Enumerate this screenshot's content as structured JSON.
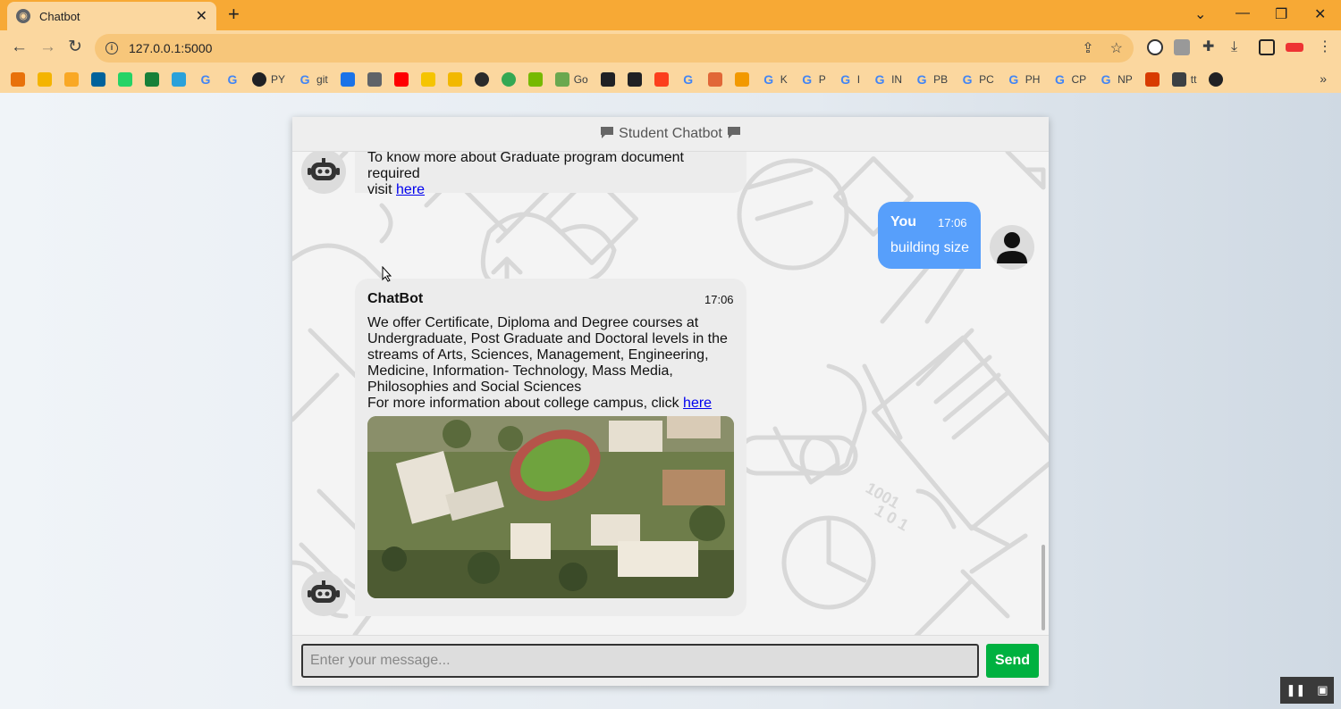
{
  "browser": {
    "tab_title": "Chatbot",
    "url": "127.0.0.1:5000",
    "bookmarks": [
      {
        "label": "",
        "icon": "bm-arrow"
      },
      {
        "label": "",
        "icon": "bm-box"
      },
      {
        "label": "",
        "icon": "bm-chart"
      },
      {
        "label": "",
        "icon": "bm-ieee"
      },
      {
        "label": "",
        "icon": "bm-whatsapp"
      },
      {
        "label": "",
        "icon": "bm-plus"
      },
      {
        "label": "",
        "icon": "bm-telegram"
      },
      {
        "label": "",
        "icon": "google"
      },
      {
        "label": "",
        "icon": "google"
      },
      {
        "label": "PY",
        "icon": "github"
      },
      {
        "label": "git",
        "icon": "google"
      },
      {
        "label": "",
        "icon": "bm-bracket"
      },
      {
        "label": "",
        "icon": "bm-stack"
      },
      {
        "label": "",
        "icon": "bm-youtube"
      },
      {
        "label": "",
        "icon": "bm-p"
      },
      {
        "label": "",
        "icon": "bm-folder"
      },
      {
        "label": "",
        "icon": "bm-dark"
      },
      {
        "label": "",
        "icon": "bm-ring"
      },
      {
        "label": "",
        "icon": "bm-nvidia"
      },
      {
        "label": "Go",
        "icon": "bm-leaf"
      },
      {
        "label": "",
        "icon": "bm-pen"
      },
      {
        "label": "",
        "icon": "bm-cl"
      },
      {
        "label": "",
        "icon": "bm-ya"
      },
      {
        "label": "",
        "icon": "google"
      },
      {
        "label": "",
        "icon": "bm-matlab"
      },
      {
        "label": "",
        "icon": "bm-cloud"
      },
      {
        "label": "K",
        "icon": "google"
      },
      {
        "label": "P",
        "icon": "google"
      },
      {
        "label": "I",
        "icon": "google"
      },
      {
        "label": "IN",
        "icon": "google"
      },
      {
        "label": "PB",
        "icon": "google"
      },
      {
        "label": "PC",
        "icon": "google"
      },
      {
        "label": "PH",
        "icon": "google"
      },
      {
        "label": "CP",
        "icon": "google"
      },
      {
        "label": "NP",
        "icon": "google"
      },
      {
        "label": "",
        "icon": "bm-office"
      },
      {
        "label": "tt",
        "icon": "bm-car"
      },
      {
        "label": "",
        "icon": "bm-globe"
      }
    ]
  },
  "chat": {
    "header_title": "Student Chatbot",
    "messages": [
      {
        "sender": "bot",
        "text": "To know more about Graduate program document required",
        "text2": "visit",
        "link_text": "here"
      },
      {
        "sender": "user",
        "name": "You",
        "time": "17:06",
        "text": "building size"
      },
      {
        "sender": "bot",
        "name": "ChatBot",
        "time": "17:06",
        "lines": [
          "We offer Certificate, Diploma and Degree courses at",
          "Undergraduate, Post Graduate and Doctoral levels in the",
          "streams of Arts, Sciences, Management, Engineering,",
          "Medicine, Information- Technology, Mass Media,",
          "Philosophies and Social Sciences"
        ],
        "link_prefix": "For more information about college campus, click",
        "link_text": "here",
        "image": "college-campus-aerial-photo"
      }
    ],
    "input_placeholder": "Enter your message...",
    "send_label": "Send"
  },
  "colors": {
    "user_bubble": "#579ffb",
    "bot_bubble": "#ececec",
    "send_button": "#00b140",
    "browser_frame": "#f7a935"
  }
}
